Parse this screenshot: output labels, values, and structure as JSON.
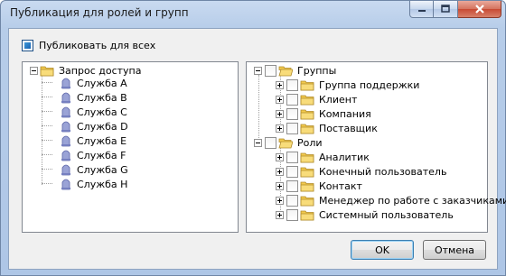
{
  "window": {
    "title": "Публикация для ролей и групп"
  },
  "publish_all": {
    "label": "Публиковать для всех",
    "checked": true
  },
  "left_tree": {
    "root_label": "Запрос доступа",
    "items": [
      {
        "label": "Служба A"
      },
      {
        "label": "Служба B"
      },
      {
        "label": "Служба C"
      },
      {
        "label": "Служба D"
      },
      {
        "label": "Служба E"
      },
      {
        "label": "Служба F"
      },
      {
        "label": "Служба G"
      },
      {
        "label": "Служба H"
      }
    ]
  },
  "right_tree": {
    "groups": {
      "label": "Группы",
      "items": [
        {
          "label": "Группа поддержки"
        },
        {
          "label": "Клиент"
        },
        {
          "label": "Компания"
        },
        {
          "label": "Поставщик"
        }
      ]
    },
    "roles": {
      "label": "Роли",
      "items": [
        {
          "label": "Аналитик"
        },
        {
          "label": "Конечный пользователь"
        },
        {
          "label": "Контакт"
        },
        {
          "label": "Менеджер по работе с заказчиками"
        },
        {
          "label": "Системный пользователь"
        }
      ]
    }
  },
  "buttons": {
    "ok": "OK",
    "cancel": "Отмена"
  },
  "colors": {
    "title_bar": "#b9cfea",
    "close_button": "#c74a33",
    "folder": "#f2c94c"
  }
}
